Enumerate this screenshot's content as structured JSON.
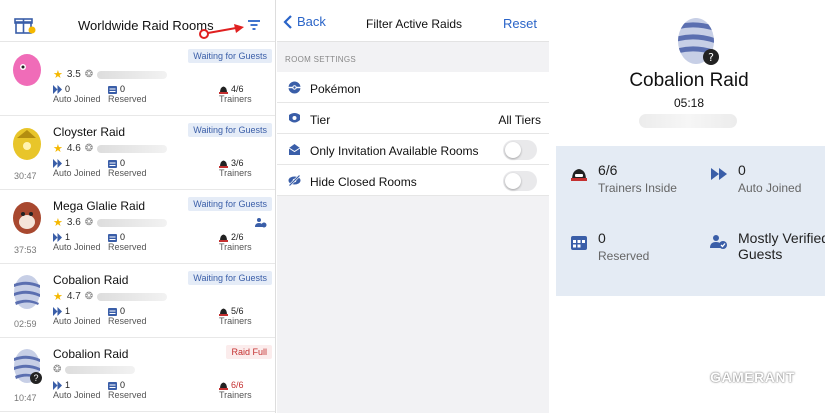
{
  "left": {
    "title": "Worldwide Raid Rooms",
    "rooms": [
      {
        "name": "",
        "rating": "3.5",
        "badge": "Waiting for Guests",
        "auto_joined": "0",
        "auto_joined_label": "Auto Joined",
        "reserved": "0",
        "reserved_label": "Reserved",
        "trainers": "4/6",
        "trainers_label": "Trainers",
        "time": "",
        "egg": "pink"
      },
      {
        "name": "Cloyster Raid",
        "rating": "4.6",
        "badge": "Waiting for Guests",
        "auto_joined": "1",
        "auto_joined_label": "Auto Joined",
        "reserved": "0",
        "reserved_label": "Reserved",
        "trainers": "3/6",
        "trainers_label": "Trainers",
        "time": "30:47",
        "egg": "yellow"
      },
      {
        "name": "Mega Glalie Raid",
        "rating": "3.6",
        "badge": "Waiting for Guests",
        "auto_joined": "1",
        "auto_joined_label": "Auto Joined",
        "reserved": "0",
        "reserved_label": "Reserved",
        "trainers": "2/6",
        "trainers_label": "Trainers",
        "time": "37:53",
        "egg": "red"
      },
      {
        "name": "Cobalion Raid",
        "rating": "4.7",
        "badge": "Waiting for Guests",
        "auto_joined": "1",
        "auto_joined_label": "Auto Joined",
        "reserved": "0",
        "reserved_label": "Reserved",
        "trainers": "5/6",
        "trainers_label": "Trainers",
        "time": "02:59",
        "egg": "striped"
      },
      {
        "name": "Cobalion Raid",
        "rating": "",
        "badge": "Raid Full",
        "auto_joined": "1",
        "auto_joined_label": "Auto Joined",
        "reserved": "0",
        "reserved_label": "Reserved",
        "trainers": "6/6",
        "trainers_label": "Trainers",
        "time": "10:47",
        "egg": "striped-q"
      }
    ]
  },
  "filter": {
    "back_label": "Back",
    "title": "Filter Active Raids",
    "reset_label": "Reset",
    "section": "ROOM SETTINGS",
    "pokemon_label": "Pokémon",
    "tier_label": "Tier",
    "tier_value": "All Tiers",
    "invitation_label": "Only Invitation Available Rooms",
    "hide_closed_label": "Hide Closed Rooms"
  },
  "detail": {
    "title": "Cobalion Raid",
    "time": "05:18",
    "trainers_value": "6/6",
    "trainers_label": "Trainers Inside",
    "auto_joined_value": "0",
    "auto_joined_label": "Auto Joined",
    "reserved_value": "0",
    "reserved_label": "Reserved",
    "guests_value": "Mostly Verified Guests"
  },
  "watermark": "GAMERANT",
  "colors": {
    "accent": "#2a64c8",
    "badge_bg": "#e5ecf7",
    "full_red": "#c43030",
    "card_bg": "#e4ebf4"
  }
}
